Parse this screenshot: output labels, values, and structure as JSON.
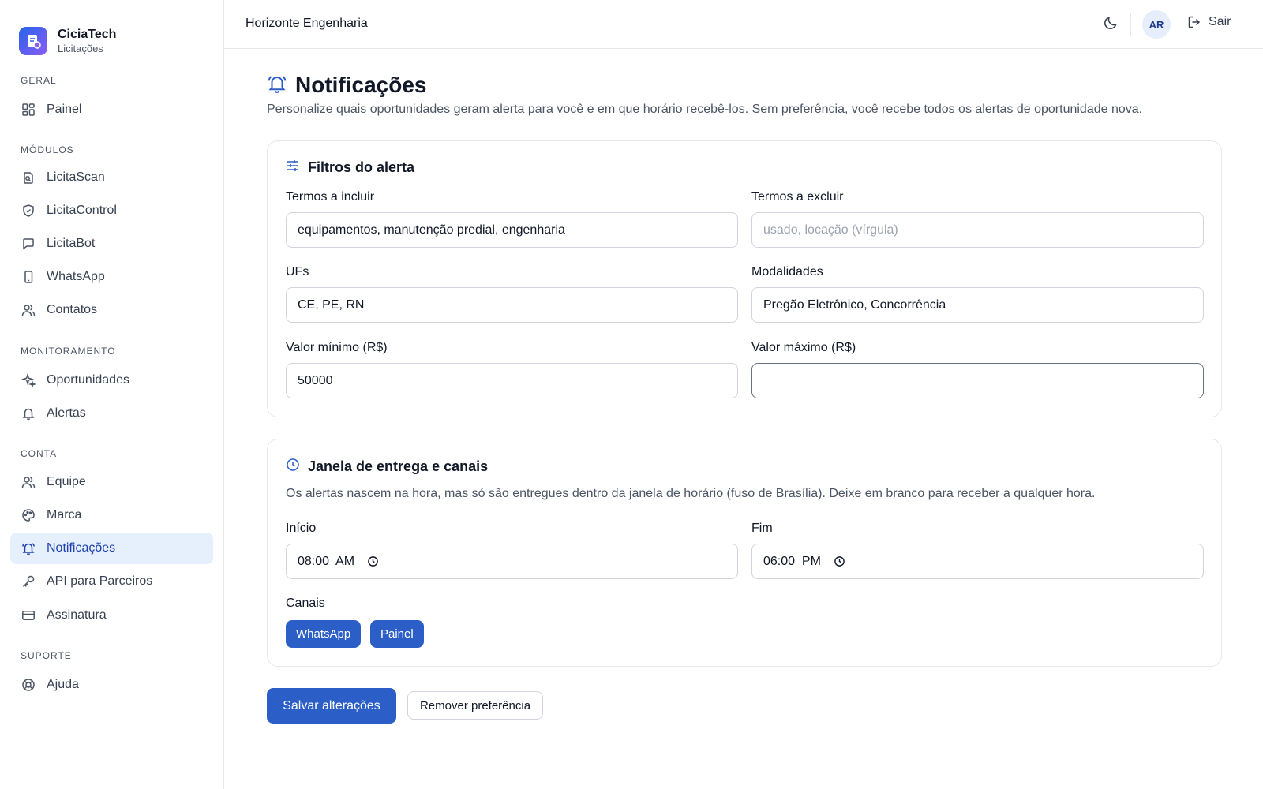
{
  "brand": {
    "name": "CiciaTech",
    "subtitle": "Licitações"
  },
  "sidebar": {
    "sections": {
      "geral": "GERAL",
      "modulos": "MÓDULOS",
      "monitoramento": "MONITORAMENTO",
      "conta": "CONTA",
      "suporte": "SUPORTE"
    },
    "items": {
      "painel": {
        "label": "Painel",
        "icon": "grid-icon"
      },
      "licitascan": {
        "label": "LicitaScan",
        "icon": "file-scan-icon"
      },
      "licitacontrol": {
        "label": "LicitaControl",
        "icon": "shield-check-icon"
      },
      "licitabot": {
        "label": "LicitaBot",
        "icon": "chat-icon"
      },
      "whatsapp": {
        "label": "WhatsApp",
        "icon": "phone-icon"
      },
      "contatos": {
        "label": "Contatos",
        "icon": "users-icon"
      },
      "oportunidades": {
        "label": "Oportunidades",
        "icon": "sparkles-icon"
      },
      "alertas": {
        "label": "Alertas",
        "icon": "bell-icon"
      },
      "equipe": {
        "label": "Equipe",
        "icon": "users-icon"
      },
      "marca": {
        "label": "Marca",
        "icon": "palette-icon"
      },
      "notificacoes": {
        "label": "Notificações",
        "icon": "bell-ring-icon",
        "active": true
      },
      "api": {
        "label": "API para Parceiros",
        "icon": "key-icon"
      },
      "assinatura": {
        "label": "Assinatura",
        "icon": "credit-card-icon"
      },
      "ajuda": {
        "label": "Ajuda",
        "icon": "lifebuoy-icon"
      }
    }
  },
  "header": {
    "company": "Horizonte Engenharia",
    "avatar_initials": "AR",
    "logout_label": "Sair"
  },
  "page": {
    "title": "Notificações",
    "description": "Personalize quais oportunidades geram alerta para você e em que horário recebê-los. Sem preferência, você recebe todos os alertas de oportunidade nova."
  },
  "filters": {
    "title": "Filtros do alerta",
    "include_label": "Termos a incluir",
    "include_value": "equipamentos, manutenção predial, engenharia",
    "exclude_label": "Termos a excluir",
    "exclude_value": "",
    "exclude_placeholder": "usado, locação (vírgula)",
    "ufs_label": "UFs",
    "ufs_value": "CE, PE, RN",
    "modalidades_label": "Modalidades",
    "modalidades_value": "Pregão Eletrônico, Concorrência",
    "min_label": "Valor mínimo (R$)",
    "min_value": "50000",
    "max_label": "Valor máximo (R$)",
    "max_value": ""
  },
  "delivery": {
    "title": "Janela de entrega e canais",
    "description": "Os alertas nascem na hora, mas só são entregues dentro da janela de horário (fuso de Brasília). Deixe em branco para receber a qualquer hora.",
    "start_label": "Início",
    "start_value": "08:00  AM",
    "end_label": "Fim",
    "end_value": "06:00  PM",
    "channels_label": "Canais",
    "channels": [
      "WhatsApp",
      "Painel"
    ]
  },
  "actions": {
    "save_label": "Salvar alterações",
    "remove_label": "Remover preferência"
  },
  "colors": {
    "primary": "#2b5fc7",
    "active_nav_bg": "#e6f0fc",
    "active_nav_text": "#1e40af"
  }
}
